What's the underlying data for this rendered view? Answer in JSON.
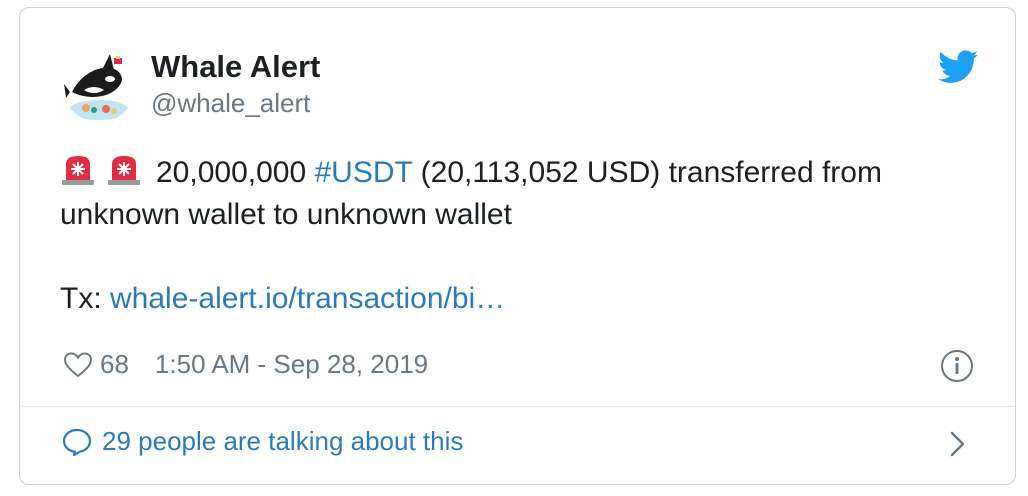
{
  "author": {
    "name": "Whale Alert",
    "handle": "@whale_alert",
    "avatar_icon": "orca-whale-avatar-icon"
  },
  "platform_icon": "twitter-bird-icon",
  "tweet": {
    "emoji": [
      "rotating-light-icon",
      "rotating-light-icon"
    ],
    "amount": "20,000,000",
    "hashtag": "#USDT",
    "rest_line1": "(20,113,052 USD) transferred from",
    "line2": "unknown wallet to unknown wallet",
    "tx_label": "Tx:",
    "tx_link": "whale-alert.io/transaction/bi…"
  },
  "meta": {
    "likes": "68",
    "timestamp": "1:50 AM - Sep 28, 2019"
  },
  "footer": {
    "conversation": "29 people are talking about this"
  },
  "colors": {
    "link": "#2b7bb9",
    "muted": "#697882",
    "twitter_blue": "#1da1f2",
    "border": "#c8d3dc"
  }
}
